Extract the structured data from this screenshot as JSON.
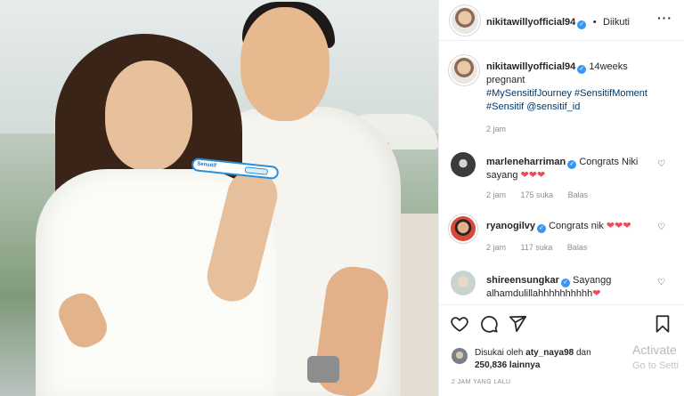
{
  "post": {
    "author": "nikitawillyofficial94",
    "follow_status": "Diikuti",
    "dot": "•",
    "more_icon": "more-horizontal-icon",
    "caption": {
      "username": "nikitawillyofficial94",
      "text": "14weeks pregnant",
      "hashtags": "#MySensitifJourney #SensitifMoment #Sensitif @sensitif_id",
      "time": "2 jam"
    },
    "comments": [
      {
        "username": "marleneharriman",
        "text": "Congrats Niki sayang",
        "emoji": "❤❤❤",
        "time": "2 jam",
        "likes": "175 suka",
        "reply": "Balas"
      },
      {
        "username": "ryanogilvy",
        "text": "Congrats nik",
        "emoji": "❤❤❤",
        "time": "2 jam",
        "likes": "117 suka",
        "reply": "Balas"
      },
      {
        "username": "shireensungkar",
        "text": "Sayangg alhamdulillahhhhhhhhhh",
        "emoji": "❤",
        "time": "",
        "likes": "",
        "reply": ""
      }
    ],
    "likes": {
      "prefix": "Disukai oleh",
      "first_user": "aty_naya98",
      "middle": "dan",
      "count": "250,836 lainnya"
    },
    "posted_ago": "2 JAM YANG LALU"
  },
  "photo": {
    "test_brand": "Sensitif"
  },
  "watermark": {
    "title": "Activate",
    "subtitle": "Go to Setti"
  },
  "colors": {
    "accent": "#3897f0",
    "heart": "#ed4956",
    "muted": "#8e8e8e"
  }
}
